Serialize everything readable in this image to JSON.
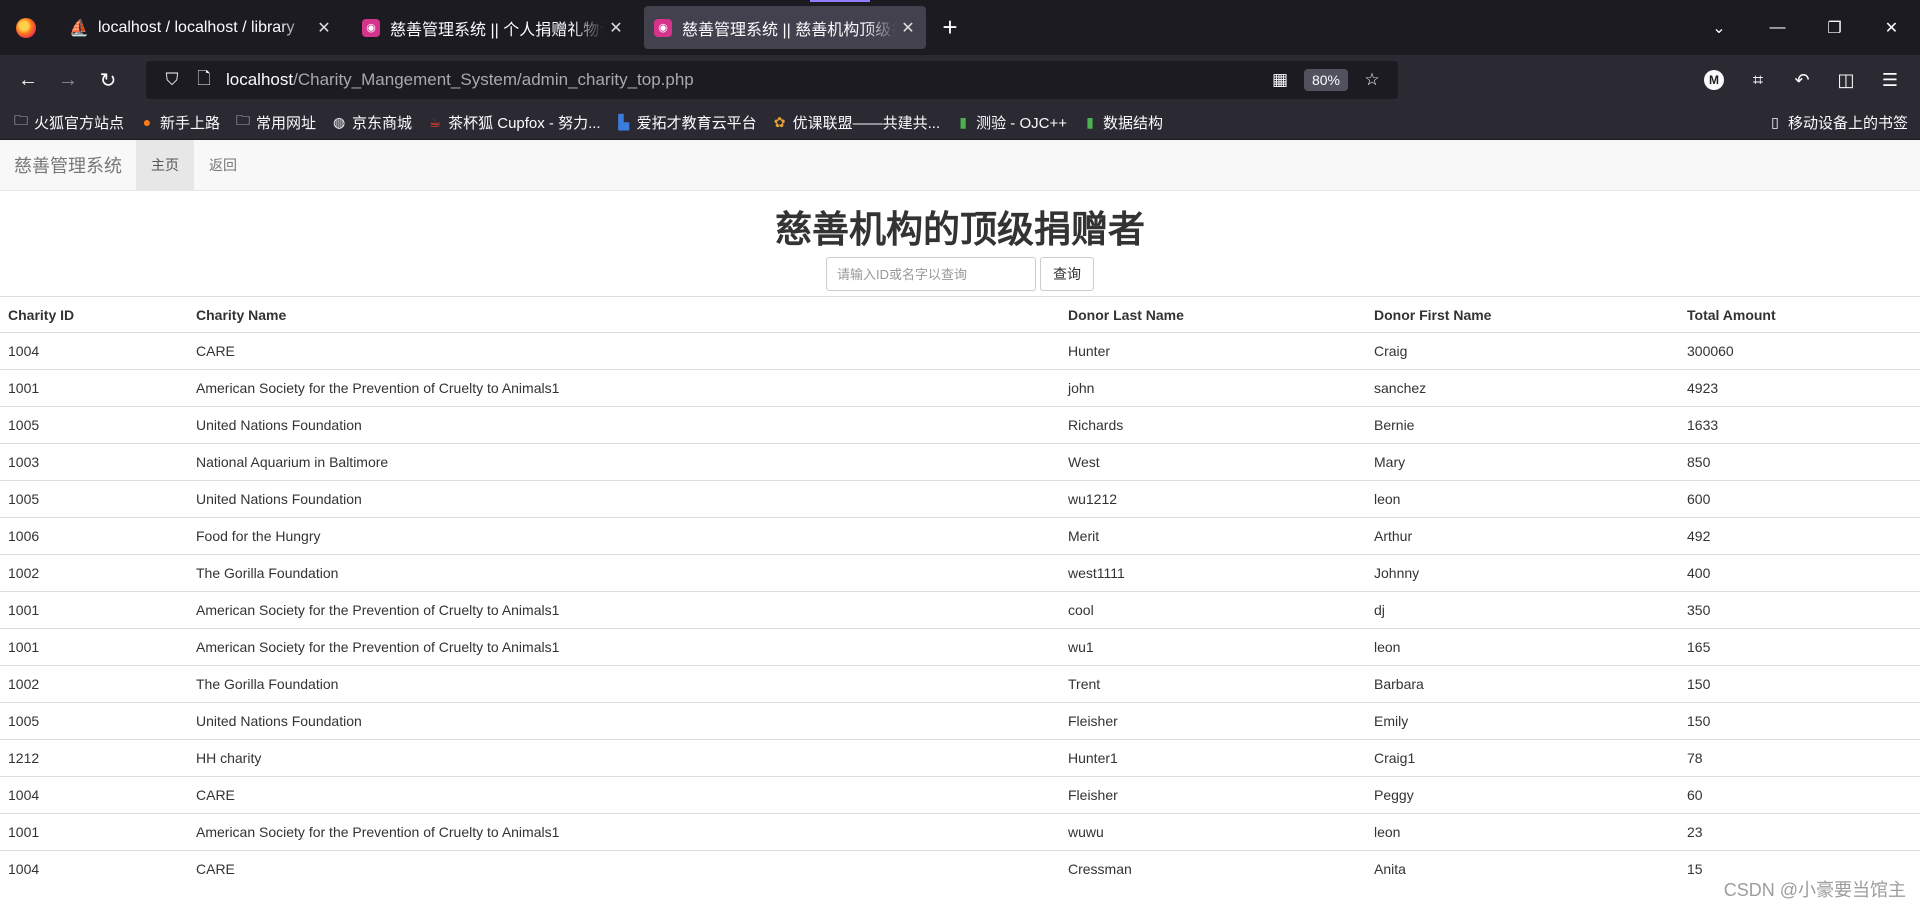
{
  "browser": {
    "tabs": [
      {
        "title": "localhost / localhost / library",
        "favicon": "phpmyadmin-icon",
        "active": false
      },
      {
        "title": "慈善管理系统 || 个人捐赠礼物记录",
        "favicon": "app-icon",
        "active": false
      },
      {
        "title": "慈善管理系统 || 慈善机构顶级捐赠者",
        "favicon": "app-icon",
        "active": true
      }
    ],
    "url_host": "localhost",
    "url_path": "/Charity_Mangement_System/admin_charity_top.php",
    "zoom": "80%",
    "bookmarks": [
      "火狐官方站点",
      "新手上路",
      "常用网址",
      "京东商城",
      "茶杯狐 Cupfox - 努力...",
      "爱拓才教育云平台",
      "优课联盟——共建共...",
      "测验 - OJC++",
      "数据结构"
    ],
    "mobile_bookmarks": "移动设备上的书签"
  },
  "app": {
    "brand": "慈善管理系统",
    "nav": {
      "home": "主页",
      "back": "返回"
    },
    "heading": "慈善机构的顶级捐赠者",
    "search": {
      "placeholder": "请输入ID或名字以查询",
      "button": "查询"
    },
    "table": {
      "headers": [
        "Charity ID",
        "Charity Name",
        "Donor Last Name",
        "Donor First Name",
        "Total Amount"
      ],
      "rows": [
        [
          "1004",
          "CARE",
          "Hunter",
          "Craig",
          "300060"
        ],
        [
          "1001",
          "American Society for the Prevention of Cruelty to Animals1",
          "john",
          "sanchez",
          "4923"
        ],
        [
          "1005",
          "United Nations Foundation",
          "Richards",
          "Bernie",
          "1633"
        ],
        [
          "1003",
          "National Aquarium in Baltimore",
          "West",
          "Mary",
          "850"
        ],
        [
          "1005",
          "United Nations Foundation",
          "wu1212",
          "leon",
          "600"
        ],
        [
          "1006",
          "Food for the Hungry",
          "Merit",
          "Arthur",
          "492"
        ],
        [
          "1002",
          "The Gorilla Foundation",
          "west1111",
          "Johnny",
          "400"
        ],
        [
          "1001",
          "American Society for the Prevention of Cruelty to Animals1",
          "cool",
          "dj",
          "350"
        ],
        [
          "1001",
          "American Society for the Prevention of Cruelty to Animals1",
          "wu1",
          "leon",
          "165"
        ],
        [
          "1002",
          "The Gorilla Foundation",
          "Trent",
          "Barbara",
          "150"
        ],
        [
          "1005",
          "United Nations Foundation",
          "Fleisher",
          "Emily",
          "150"
        ],
        [
          "1212",
          "HH charity",
          "Hunter1",
          "Craig1",
          "78"
        ],
        [
          "1004",
          "CARE",
          "Fleisher",
          "Peggy",
          "60"
        ],
        [
          "1001",
          "American Society for the Prevention of Cruelty to Animals1",
          "wuwu",
          "leon",
          "23"
        ],
        [
          "1004",
          "CARE",
          "Cressman",
          "Anita",
          "15"
        ]
      ]
    },
    "watermark": "CSDN @小豪要当馆主"
  }
}
